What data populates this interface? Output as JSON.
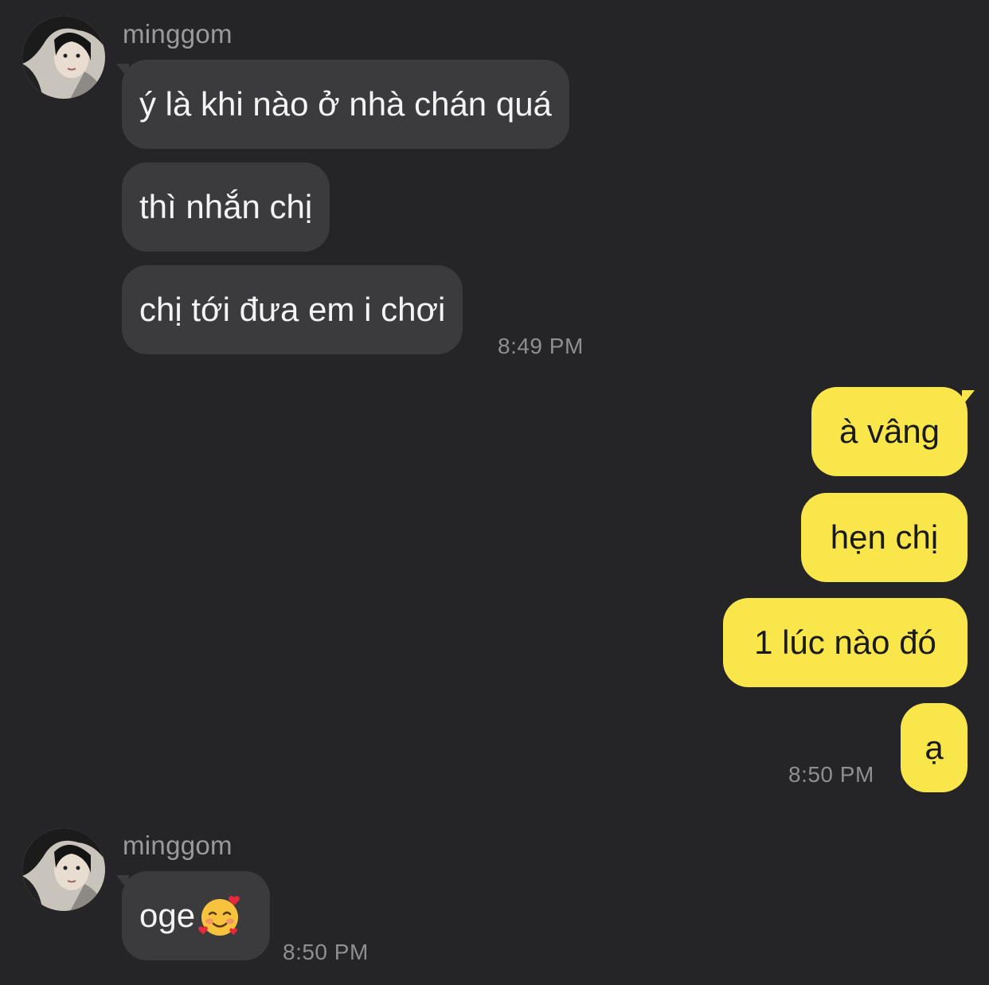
{
  "chat": {
    "groups": [
      {
        "sender": "minggom",
        "direction": "incoming",
        "messages": [
          "ý là khi nào ở nhà chán quá",
          "thì nhắn chị",
          "chị tới đưa em i chơi"
        ],
        "time": "8:49 PM"
      },
      {
        "direction": "outgoing",
        "messages": [
          "à vâng",
          "hẹn chị",
          "1 lúc nào đó",
          "ạ"
        ],
        "time": "8:50 PM"
      },
      {
        "sender": "minggom",
        "direction": "incoming",
        "messages": [
          "oge"
        ],
        "emoji": "smiling-face-with-hearts",
        "time": "8:50 PM"
      }
    ]
  },
  "colors": {
    "background": "#252527",
    "incoming_bubble": "#3b3b3d",
    "outgoing_bubble": "#f9e64b",
    "timestamp": "#8f8f91",
    "sender_name": "#9a9a9c"
  },
  "icons": {
    "avatar": "profile-photo",
    "reaction_emoji": "smiling-face-with-hearts-icon"
  }
}
